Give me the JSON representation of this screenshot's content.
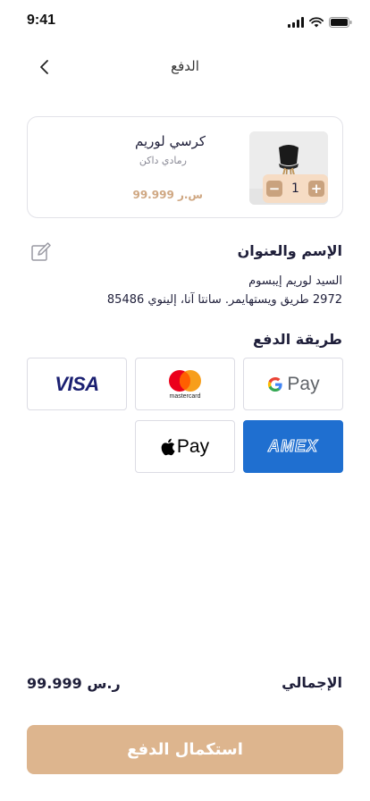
{
  "status": {
    "time": "9:41"
  },
  "header": {
    "title": "الدفع"
  },
  "product": {
    "name": "كرسي لوريم",
    "variant": "رمادي داكن",
    "price": "99.999 س.ر",
    "quantity": "1",
    "minus": "−",
    "plus": "+"
  },
  "address": {
    "title": "الإسم والعنوان",
    "name": "السيد لوريم إيبسوم",
    "street": "2972 طريق ويستهايمر. سانتا آنا، إلينوي 85486"
  },
  "payment": {
    "title": "طريقة الدفع",
    "methods": [
      {
        "id": "gpay",
        "label": "Pay",
        "prefix": "G",
        "selected": false
      },
      {
        "id": "mastercard",
        "label": "mastercard",
        "selected": false
      },
      {
        "id": "visa",
        "label": "VISA",
        "selected": false
      },
      {
        "id": "amex",
        "label": "AMEX",
        "selected": true
      },
      {
        "id": "applepay",
        "label": "Pay",
        "selected": false
      }
    ]
  },
  "total": {
    "label": "الإجمالي",
    "value": "99.999 ر.س"
  },
  "checkout": {
    "label": "استكمال الدفع"
  },
  "colors": {
    "accent": "#ddb58e",
    "price": "#cfa782",
    "amex_bg": "#1f6fd0",
    "stepper_bg": "#f6dcc4",
    "text": "#1f1f3a"
  }
}
